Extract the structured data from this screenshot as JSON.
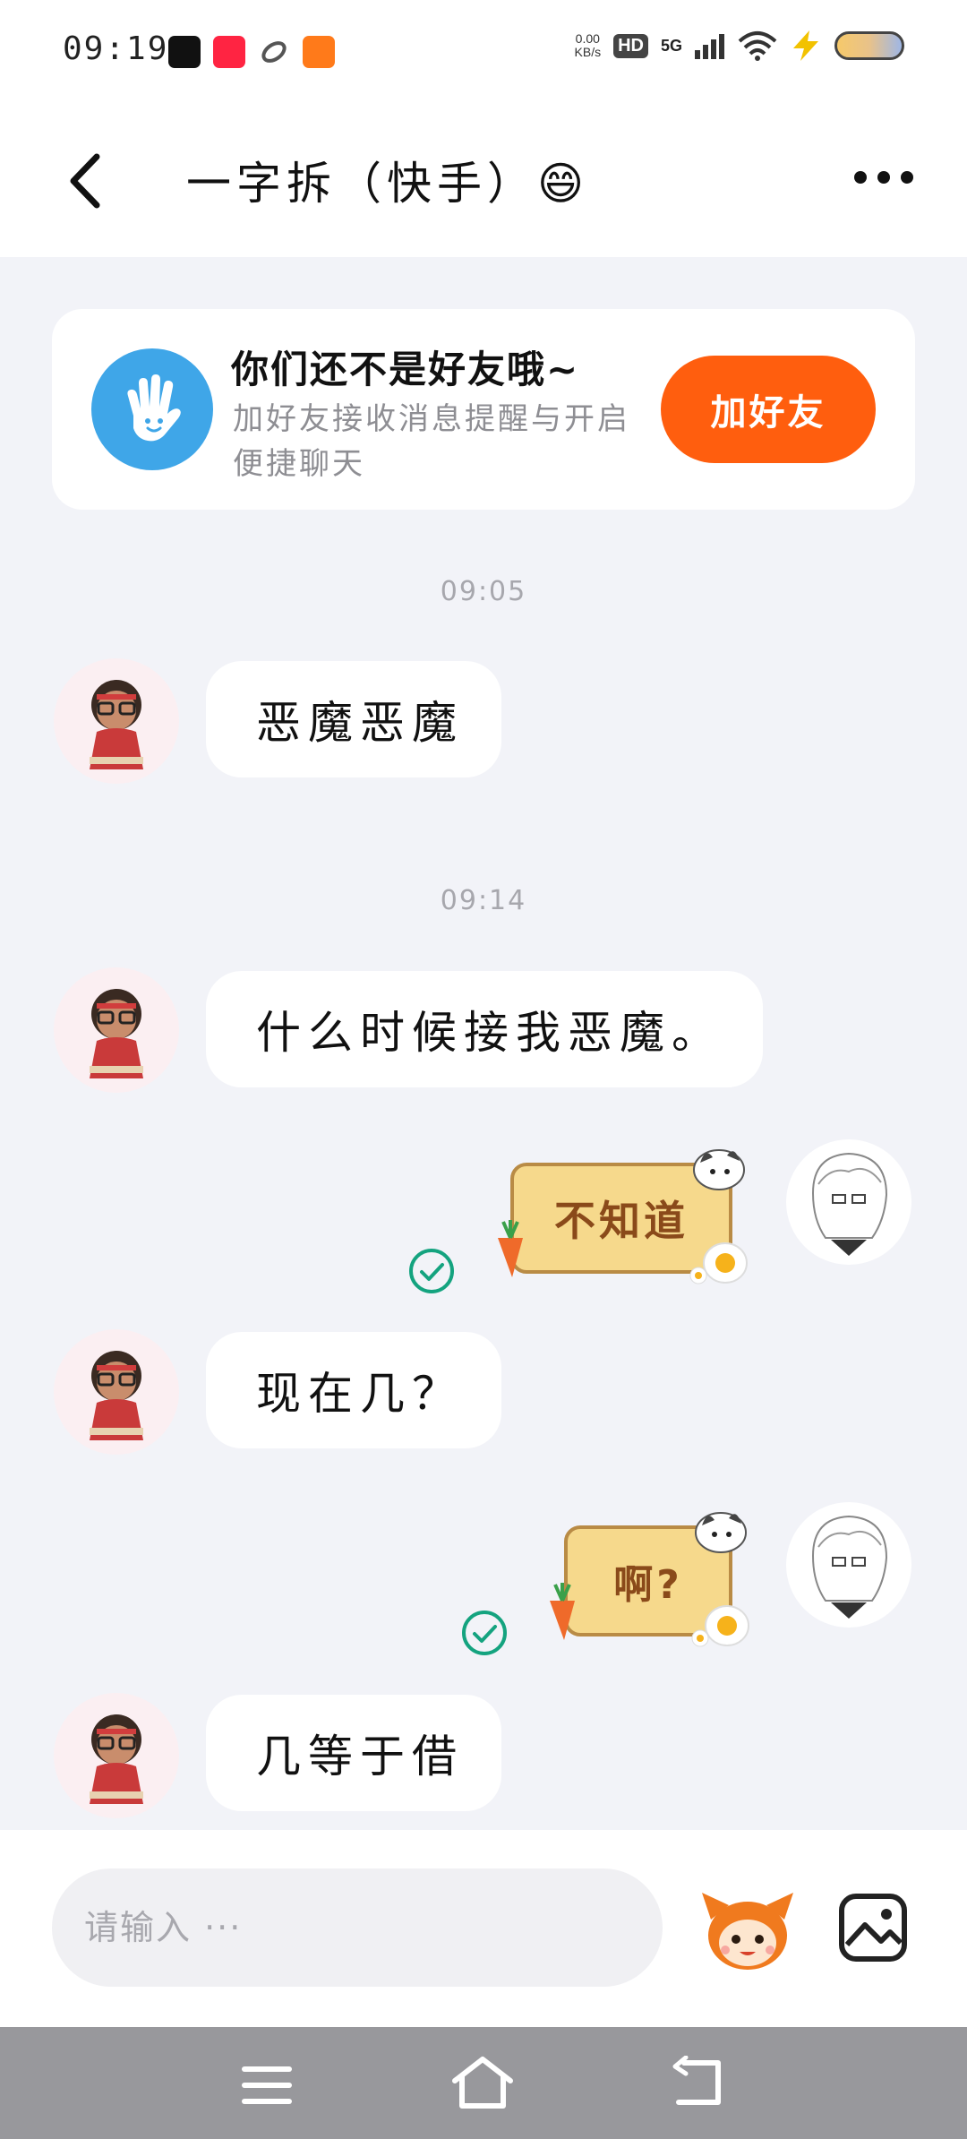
{
  "status_bar": {
    "time": "09:19",
    "network_speed_value": "0.00",
    "network_speed_unit": "KB/s",
    "hd_label": "HD",
    "signal_label": "5G"
  },
  "header": {
    "title": "一字拆（快手）😄"
  },
  "friend_banner": {
    "title": "你们还不是好友哦~",
    "subtitle": "加好友接收消息提醒与开启便捷聊天",
    "button_label": "加好友"
  },
  "messages": {
    "timestamp_1": "09:05",
    "msg_1": "恶魔恶魔",
    "timestamp_2": "09:14",
    "msg_2": "什么时候接我恶魔。",
    "sticker_1": "不知道",
    "msg_3": "现在几？",
    "sticker_2": "啊?",
    "msg_4": "几等于借"
  },
  "input_bar": {
    "placeholder": "请输入 ···"
  },
  "colors": {
    "accent": "#ff5e0e",
    "banner_icon": "#3fa6e8",
    "read_check": "#14a37f",
    "background": "#f2f3f8"
  },
  "icons": [
    "back-icon",
    "more-icon",
    "hand-wave-icon",
    "check-circle-icon",
    "mascot-emoji-icon",
    "image-icon",
    "menu-icon",
    "home-icon",
    "nav-back-icon"
  ]
}
